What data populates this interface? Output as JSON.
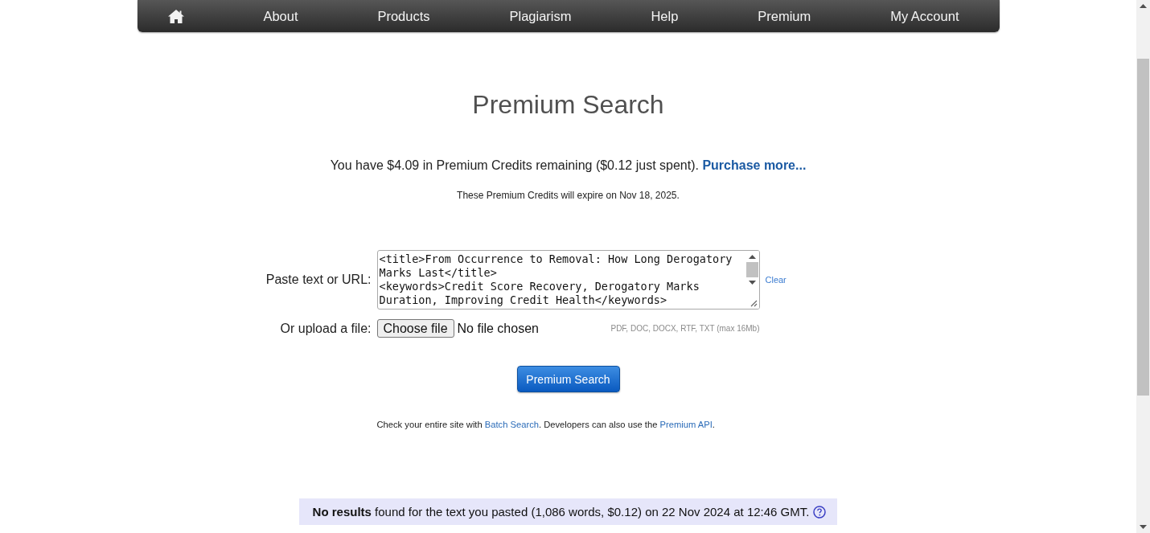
{
  "nav": {
    "items": [
      "About",
      "Products",
      "Plagiarism",
      "Help",
      "Premium",
      "My Account"
    ]
  },
  "page": {
    "title": "Premium Search"
  },
  "credits": {
    "segments": [
      {
        "kind": "text",
        "text": "You have $4.09 in Premium Credits remaining ($0.12 just spent). "
      },
      {
        "kind": "link",
        "text": "Purchase more..."
      }
    ],
    "expiry": "These Premium Credits will expire on Nov 18, 2025."
  },
  "form": {
    "text_input": {
      "label": "Paste text or URL:",
      "value": "<title>From Occurrence to Removal: How Long Derogatory Marks Last</title>\n<keywords>Credit Score Recovery, Derogatory Marks Duration, Improving Credit Health</keywords>",
      "clear": "Clear"
    },
    "upload": {
      "label": "Or upload a file:",
      "button": "Choose file",
      "status": "No file chosen",
      "hint": "PDF, DOC, DOCX, RTF, TXT (max 16Mb)"
    },
    "submit": "Premium Search"
  },
  "note": {
    "segments": [
      {
        "kind": "text",
        "text": "Check your entire site with "
      },
      {
        "kind": "link",
        "text": "Batch Search"
      },
      {
        "kind": "text",
        "text": ". Developers can also use the "
      },
      {
        "kind": "link",
        "text": "Premium API"
      },
      {
        "kind": "text",
        "text": "."
      }
    ]
  },
  "result": {
    "text": "**No results** found for the text you pasted (1,086 words, $0.12) on 22 Nov 2024 at 12:46 GMT."
  }
}
